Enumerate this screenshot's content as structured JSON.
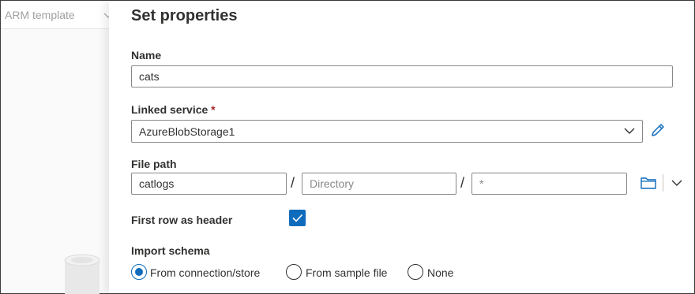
{
  "background": {
    "tab_label": "ARM template"
  },
  "panel": {
    "title": "Set properties",
    "name": {
      "label": "Name",
      "value": "cats"
    },
    "linked_service": {
      "label": "Linked service",
      "required_mark": "*",
      "value": "AzureBlobStorage1"
    },
    "file_path": {
      "label": "File path",
      "container": "catlogs",
      "directory_placeholder": "Directory",
      "file": "*",
      "separator": "/"
    },
    "first_row_header": {
      "label": "First row as header",
      "checked": true
    },
    "import_schema": {
      "label": "Import schema",
      "options": [
        {
          "label": "From connection/store",
          "selected": true
        },
        {
          "label": "From sample file",
          "selected": false
        },
        {
          "label": "None",
          "selected": false
        }
      ]
    }
  },
  "colors": {
    "accent": "#0f6cbd",
    "required": "#a4262c"
  }
}
